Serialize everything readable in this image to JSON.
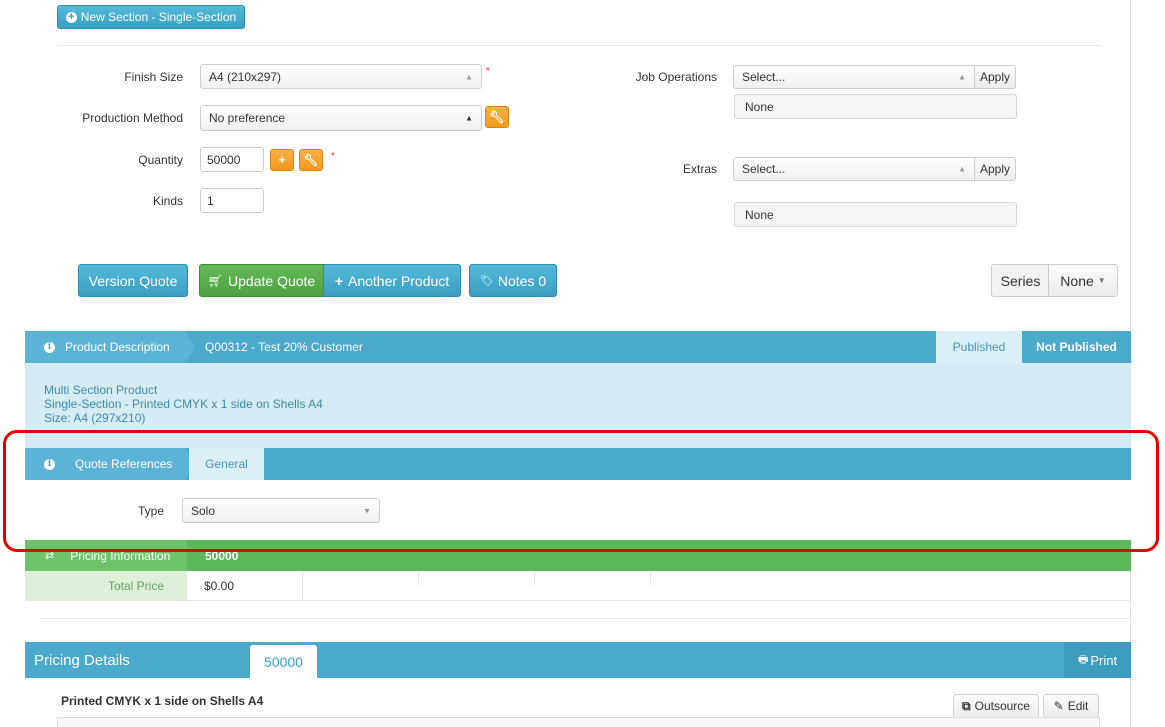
{
  "toolbar": {
    "new_section_label": "New Section - Single-Section"
  },
  "form": {
    "finish_size": {
      "label": "Finish Size",
      "value": "A4 (210x297)",
      "required": "*"
    },
    "production_method": {
      "label": "Production Method",
      "value": "No preference"
    },
    "quantity": {
      "label": "Quantity",
      "value": "50000",
      "required": "*"
    },
    "kinds": {
      "label": "Kinds",
      "value": "1"
    },
    "job_operations": {
      "label": "Job Operations",
      "placeholder": "Select...",
      "apply": "Apply",
      "selected": "None"
    },
    "extras": {
      "label": "Extras",
      "placeholder": "Select...",
      "apply": "Apply",
      "selected": "None"
    }
  },
  "actions": {
    "version_quote": "Version Quote",
    "update_quote": "Update Quote",
    "another_product": "Another Product",
    "notes": "Notes 0",
    "series_label": "Series",
    "series_value": "None"
  },
  "product_description": {
    "title": "Product Description",
    "quote": "Q00312 - Test 20% Customer",
    "published": "Published",
    "not_published": "Not Published",
    "lines": [
      "Multi Section Product",
      "Single-Section - Printed CMYK x 1 side on Shells A4",
      "Size: A4 (297x210)"
    ]
  },
  "quote_references": {
    "title": "Quote References",
    "tab": "General",
    "type_label": "Type",
    "type_value": "Solo"
  },
  "pricing_information": {
    "title": "Pricing Information",
    "quantity": "50000",
    "total_label": "Total Price",
    "total_value": "$0.00"
  },
  "pricing_details": {
    "title": "Pricing Details",
    "tab": "50000",
    "print": "Print",
    "item_title": "Printed CMYK x 1 side on Shells A4",
    "outsource": "Outsource",
    "edit": "Edit"
  },
  "colors": {
    "primary_blue": "#4ba9cc",
    "green": "#5cb85c",
    "orange": "#f39a1a",
    "highlight": "#e40000"
  }
}
